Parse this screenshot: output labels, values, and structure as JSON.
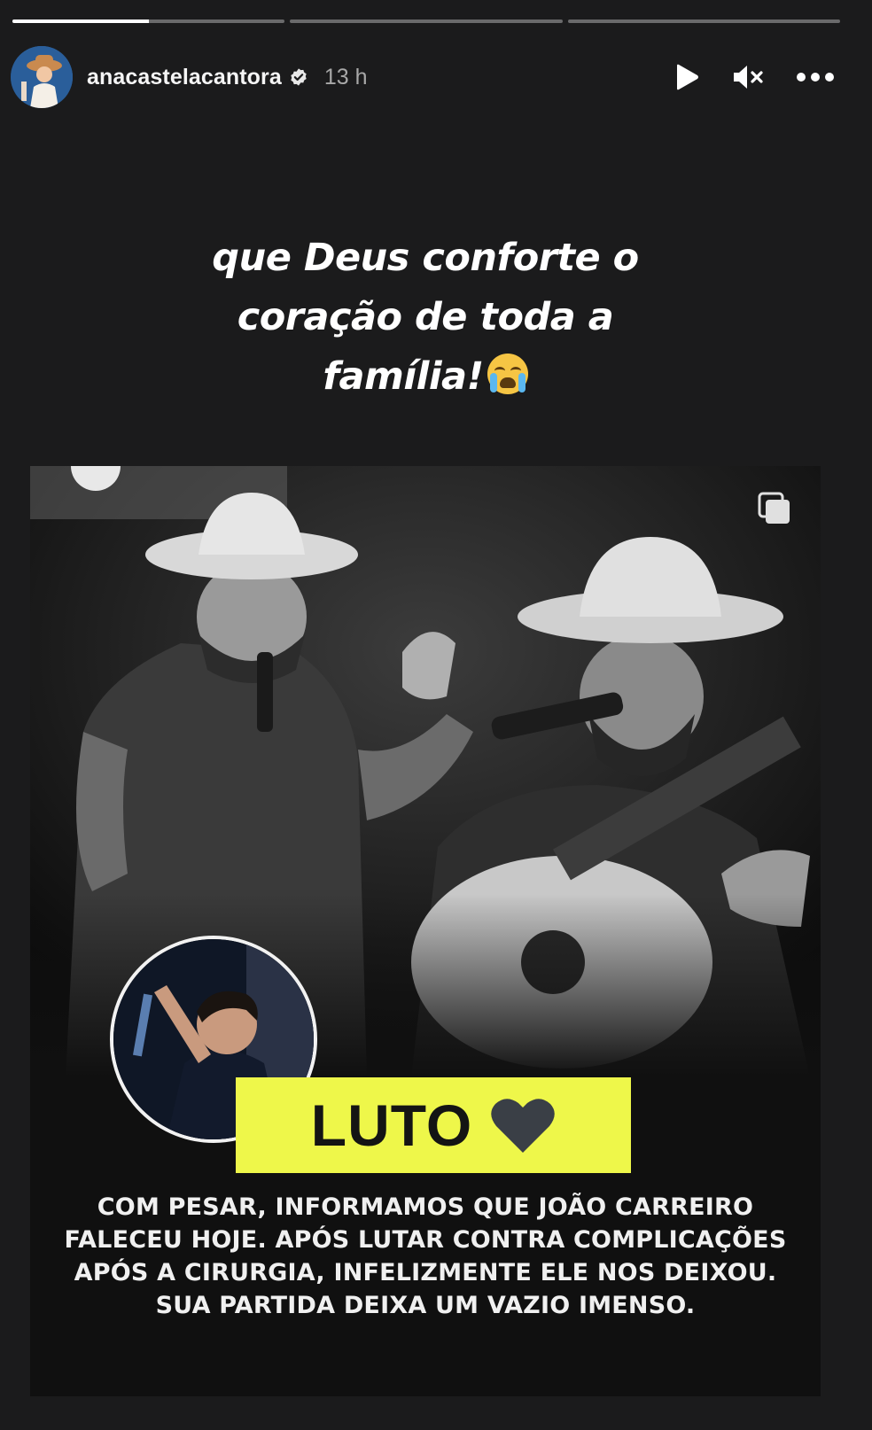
{
  "story": {
    "progress_segments": [
      {
        "label": "segment-1",
        "fill": 0.5
      },
      {
        "label": "segment-2",
        "fill": 0
      },
      {
        "label": "segment-3",
        "fill": 0
      }
    ],
    "header": {
      "username": "anacastelacantora",
      "time": "13 h",
      "icons": [
        "play-icon",
        "muted-speaker-icon",
        "more-options-icon",
        "verified-badge-icon"
      ]
    },
    "caption": {
      "text": "que Deus conforte o coração de toda a família!",
      "emoji": "loudly-crying-face"
    }
  },
  "post": {
    "badge_text": "LUTO",
    "badge_icon": "black-heart",
    "announcement": "COM PESAR, INFORMAMOS QUE JOÃO CARREIRO FALECEU HOJE. APÓS LUTAR CONTRA COMPLICAÇÕES APÓS A CIRURGIA, INFELIZMENTE ELE NOS DEIXOU. SUA PARTIDA DEIXA UM VAZIO IMENSO."
  },
  "colors": {
    "background": "#1b1b1c",
    "badge_yellow": "#eef74a",
    "text_white": "#ffffff",
    "time_gray": "#a8a8a8"
  }
}
